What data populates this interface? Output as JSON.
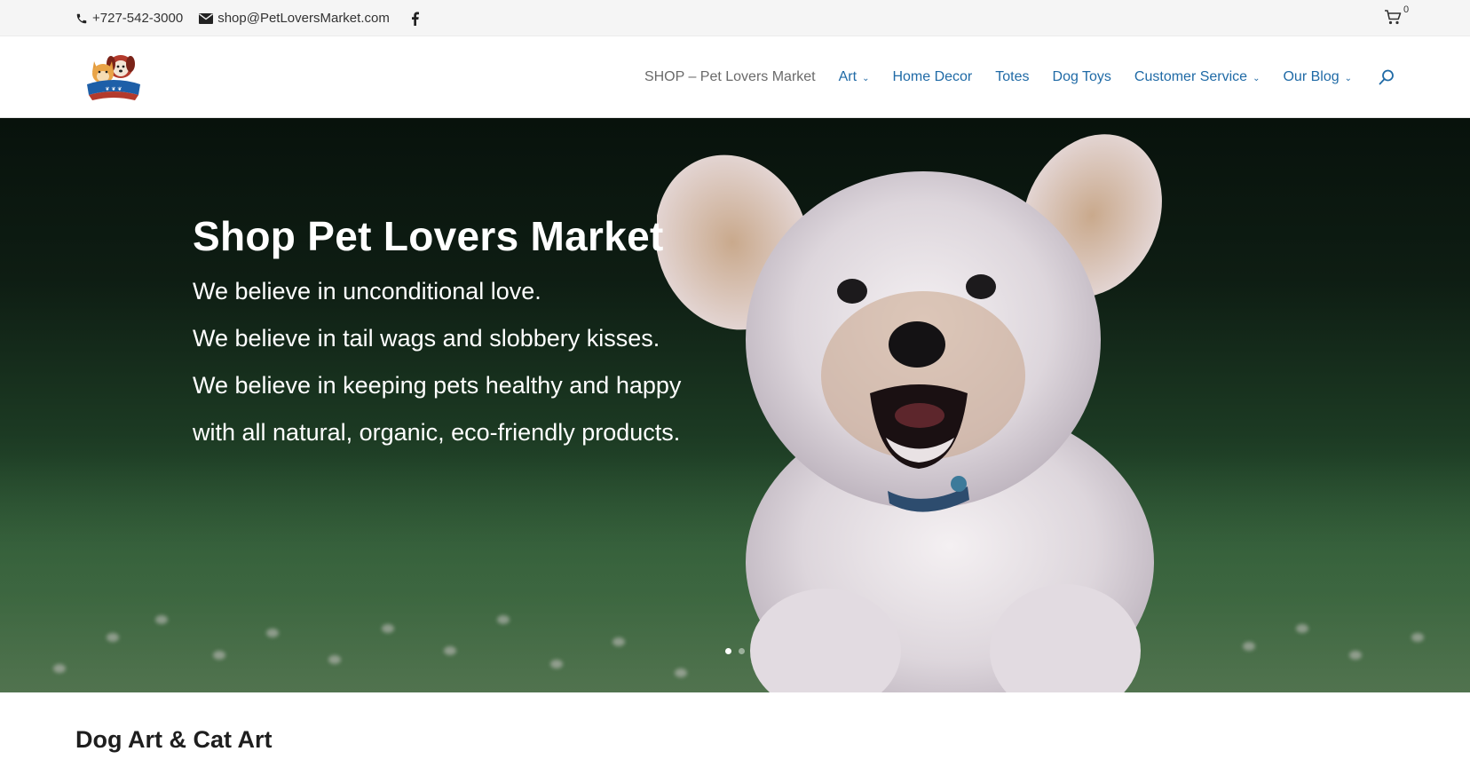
{
  "topbar": {
    "phone": "+727-542-3000",
    "email": "shop@PetLoversMarket.com",
    "social_icon": "facebook-icon",
    "cart_count": "0"
  },
  "header": {
    "logo_icon": "pet-lovers-market-logo",
    "nav": [
      {
        "label": "SHOP – Pet Lovers Market",
        "current": true,
        "dropdown": false
      },
      {
        "label": "Art",
        "dropdown": true
      },
      {
        "label": "Home Decor",
        "dropdown": false
      },
      {
        "label": "Totes",
        "dropdown": false
      },
      {
        "label": "Dog Toys",
        "dropdown": false
      },
      {
        "label": "Customer Service",
        "dropdown": true
      },
      {
        "label": "Our Blog",
        "dropdown": true
      }
    ],
    "search_icon": "search-icon"
  },
  "hero": {
    "title": "Shop Pet Lovers Market",
    "lines": [
      "We believe in unconditional love.",
      "We believe in tail wags and slobbery kisses.",
      "We believe in keeping pets healthy and happy",
      "with all natural, organic, eco-friendly products."
    ],
    "slide_count": 2,
    "active_slide": 1
  },
  "section": {
    "title": "Dog Art & Cat Art"
  },
  "colors": {
    "nav_link": "#1f6aa6",
    "nav_current": "#6a6a6a",
    "topbar_bg": "#f5f5f5",
    "hero_text": "#ffffff"
  }
}
